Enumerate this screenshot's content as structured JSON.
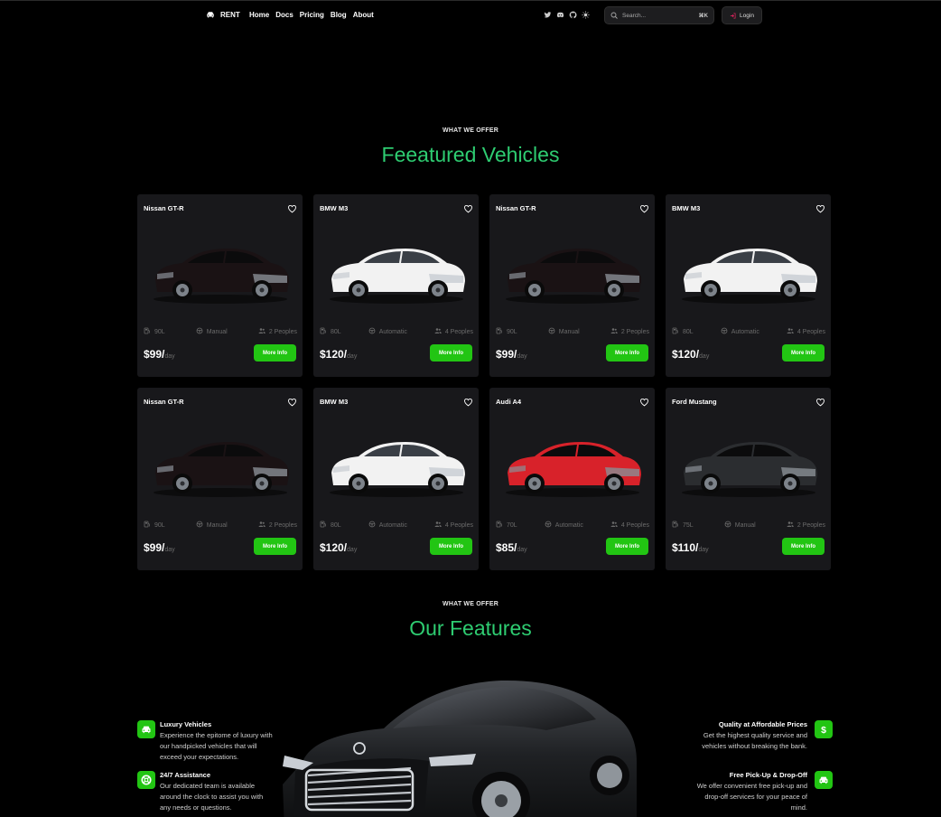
{
  "nav": {
    "brand": "RENT",
    "links": [
      "Home",
      "Docs",
      "Pricing",
      "Blog",
      "About"
    ],
    "search_placeholder": "Search...",
    "search_shortcut": "⌘K",
    "login_label": "Login"
  },
  "featured": {
    "eyebrow": "WHAT WE OFFER",
    "title": "Feeatured Vehicles",
    "more_label": "More Info",
    "price_unit": "day",
    "cars": [
      {
        "name": "Nissan GT-R",
        "fuel": "90L",
        "transmission": "Manual",
        "seats": "2 Peoples",
        "price": "$99/",
        "color": "#1a1214"
      },
      {
        "name": "BMW M3",
        "fuel": "80L",
        "transmission": "Automatic",
        "seats": "4 Peoples",
        "price": "$120/",
        "color": "#f2f2f2"
      },
      {
        "name": "Nissan GT-R",
        "fuel": "90L",
        "transmission": "Manual",
        "seats": "2 Peoples",
        "price": "$99/",
        "color": "#1a1214"
      },
      {
        "name": "BMW M3",
        "fuel": "80L",
        "transmission": "Automatic",
        "seats": "4 Peoples",
        "price": "$120/",
        "color": "#f2f2f2"
      },
      {
        "name": "Nissan GT-R",
        "fuel": "90L",
        "transmission": "Manual",
        "seats": "2 Peoples",
        "price": "$99/",
        "color": "#1a1214"
      },
      {
        "name": "BMW M3",
        "fuel": "80L",
        "transmission": "Automatic",
        "seats": "4 Peoples",
        "price": "$120/",
        "color": "#f2f2f2"
      },
      {
        "name": "Audi A4",
        "fuel": "70L",
        "transmission": "Automatic",
        "seats": "4 Peoples",
        "price": "$85/",
        "color": "#d8222a"
      },
      {
        "name": "Ford Mustang",
        "fuel": "75L",
        "transmission": "Manual",
        "seats": "2 Peoples",
        "price": "$110/",
        "color": "#2b2d30"
      }
    ]
  },
  "features": {
    "eyebrow": "WHAT WE OFFER",
    "title": "Our Features",
    "items": [
      {
        "title": "Luxury Vehicles",
        "desc": "Experience the epitome of luxury with our handpicked vehicles that will exceed your expectations.",
        "icon": "car-icon"
      },
      {
        "title": "24/7 Assistance",
        "desc": "Our dedicated team is available around the clock to assist you with any needs or questions.",
        "icon": "lifebuoy-icon"
      },
      {
        "title": "Quality at Affordable Prices",
        "desc": "Get the highest quality service and vehicles without breaking the bank.",
        "icon": "dollar-icon"
      },
      {
        "title": "Free Pick-Up & Drop-Off",
        "desc": "We offer convenient free pick-up and drop-off services for your peace of mind.",
        "icon": "car-icon"
      }
    ]
  },
  "colors": {
    "accent": "#22c513",
    "heading": "#2ecc71",
    "card_bg": "#18181b"
  }
}
